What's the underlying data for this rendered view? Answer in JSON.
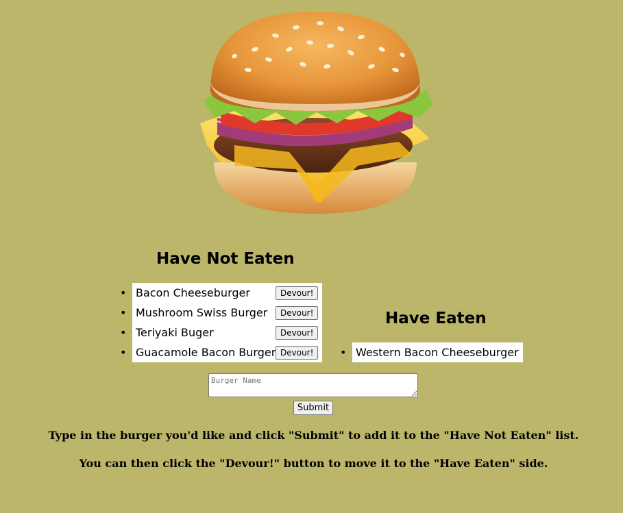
{
  "hero": {
    "icon": "burger-illustration"
  },
  "not_eaten": {
    "title": "Have Not Eaten",
    "items": [
      {
        "name": "Bacon Cheeseburger",
        "button": "Devour!"
      },
      {
        "name": "Mushroom Swiss Burger",
        "button": "Devour!"
      },
      {
        "name": "Teriyaki Buger",
        "button": "Devour!"
      },
      {
        "name": "Guacamole Bacon Burger",
        "button": "Devour!"
      }
    ]
  },
  "eaten": {
    "title": "Have Eaten",
    "items": [
      {
        "name": "Western Bacon Cheeseburger"
      }
    ]
  },
  "form": {
    "placeholder": "Burger Name",
    "submit_label": "Submit"
  },
  "instructions": {
    "line1": "Type in the burger you'd like and click \"Submit\" to add it to the \"Have Not Eaten\" list.",
    "line2": "You can then click the \"Devour!\" button to move it to the \"Have Eaten\" side."
  },
  "colors": {
    "background": "#bcb66a",
    "bun": "#e59a3c",
    "lettuce": "#8cc63f",
    "tomato": "#e0392b",
    "onion": "#a23c78",
    "patty": "#6b3a1f",
    "cheese": "#f7c52a"
  }
}
